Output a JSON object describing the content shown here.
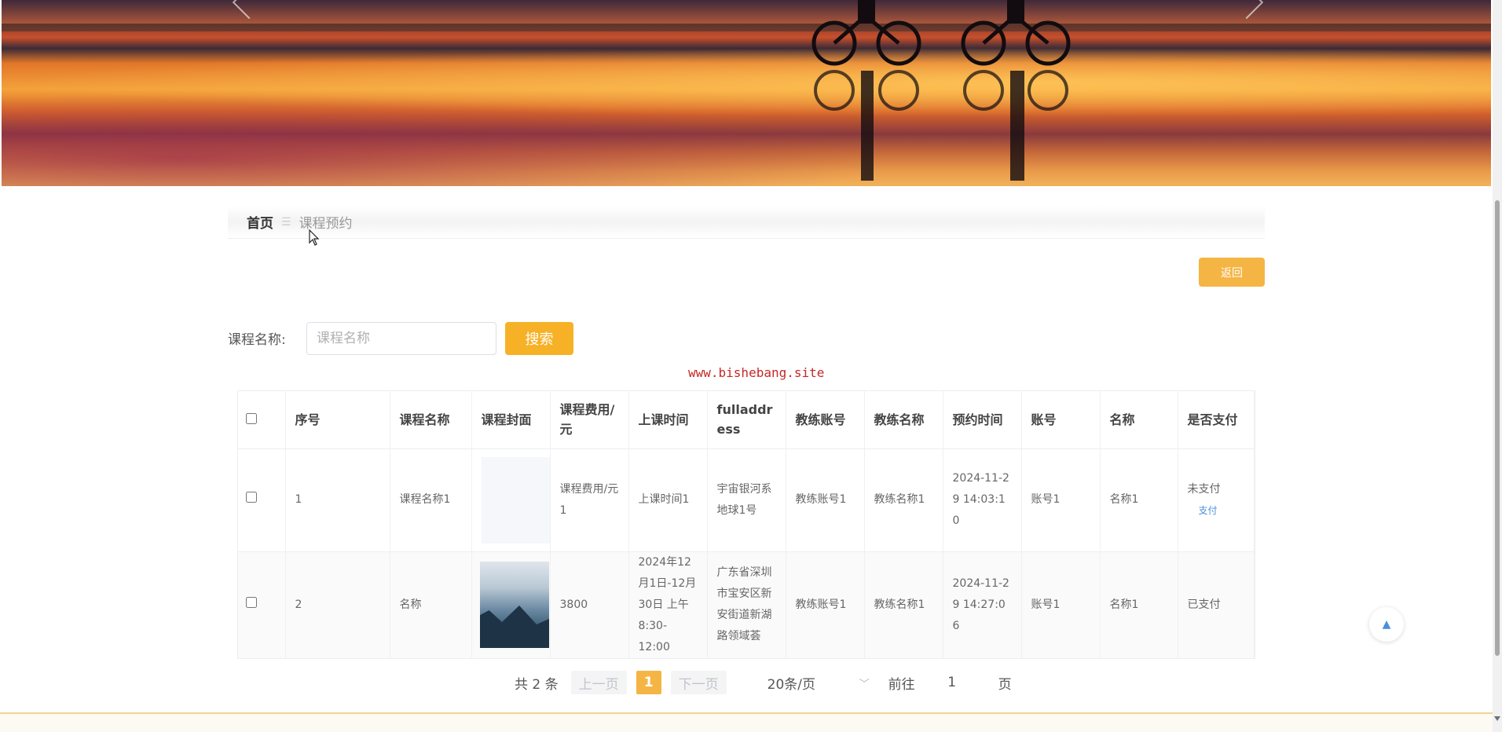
{
  "breadcrumb": {
    "home": "首页",
    "current": "课程预约"
  },
  "back_label": "返回",
  "search": {
    "label": "课程名称:",
    "placeholder": "课程名称",
    "button": "搜索"
  },
  "watermark": "www.bishebang.site",
  "table": {
    "headers": [
      "序号",
      "课程名称",
      "课程封面",
      "课程费用/元",
      "上课时间",
      "fulladdress",
      "教练账号",
      "教练名称",
      "预约时间",
      "账号",
      "名称",
      "是否支付"
    ],
    "rows": [
      {
        "index": "1",
        "course_name": "课程名称1",
        "cover": "blank",
        "fee": "课程费用/元1",
        "class_time": "上课时间1",
        "address": "宇宙银河系地球1号",
        "coach_account": "教练账号1",
        "coach_name": "教练名称1",
        "booking_time": "2024-11-29 14:03:10",
        "account": "账号1",
        "name": "名称1",
        "paid": "未支付",
        "pay_link": "支付"
      },
      {
        "index": "2",
        "course_name": "名称",
        "cover": "mountain",
        "fee": "3800",
        "class_time": "2024年12月1日-12月30日 上午8:30-12:00",
        "address": "广东省深圳市宝安区新安街道新湖路领域荟",
        "coach_account": "教练账号1",
        "coach_name": "教练名称1",
        "booking_time": "2024-11-29 14:27:06",
        "account": "账号1",
        "name": "名称1",
        "paid": "已支付"
      }
    ]
  },
  "pagination": {
    "total": "共 2 条",
    "prev": "上一页",
    "current_page": "1",
    "next": "下一页",
    "page_size": "20条/页",
    "goto": "前往",
    "goto_value": "1",
    "unit": "页"
  },
  "colors": {
    "accent": "#f7b126",
    "link": "#4a90d9",
    "watermark": "#c62828"
  }
}
